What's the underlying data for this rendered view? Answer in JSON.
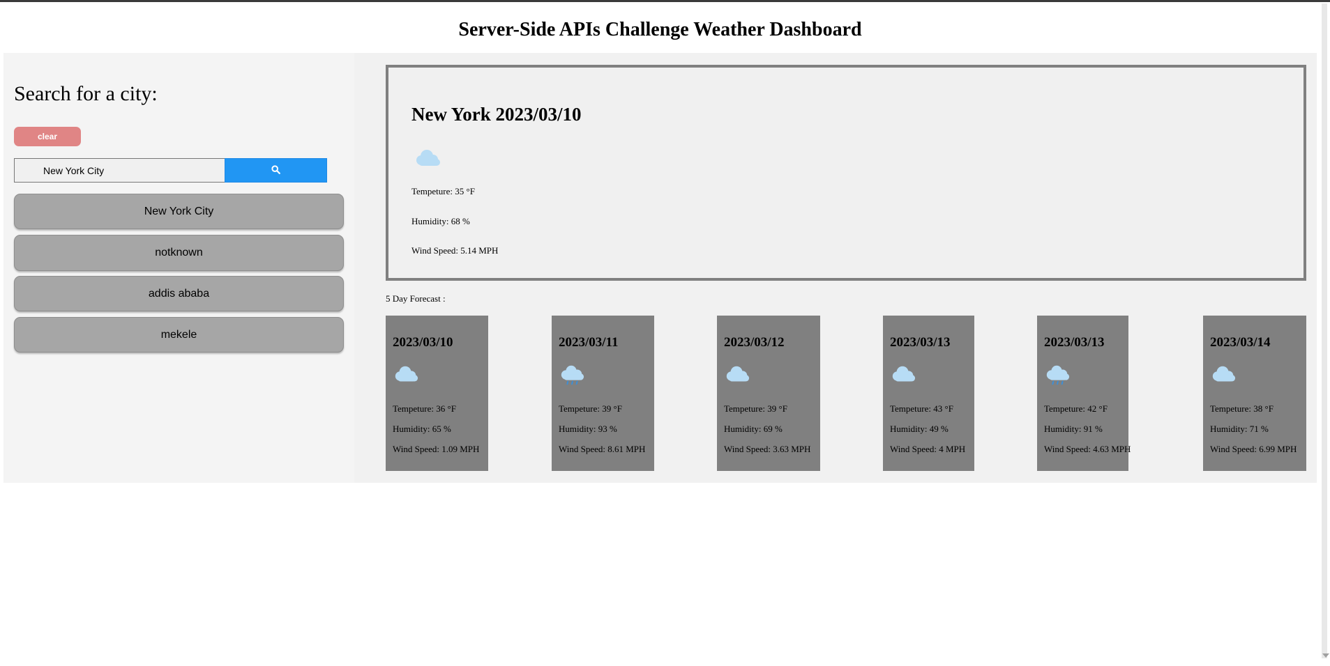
{
  "page": {
    "title": "Server-Side APIs Challenge Weather Dashboard"
  },
  "sidebar": {
    "heading": "Search for a city:",
    "clear_label": "clear",
    "search": {
      "value": "New York City",
      "icon": "search-icon"
    },
    "history": [
      "New York City",
      "notknown",
      "addis ababa",
      "mekele"
    ]
  },
  "current": {
    "title": "New York 2023/03/10",
    "icon": "cloud-icon",
    "temperature": "Tempeture: 35 °F",
    "humidity": "Humidity: 68 %",
    "wind": "Wind Speed: 5.14 MPH"
  },
  "forecast": {
    "label": "5 Day Forecast :",
    "cards": [
      {
        "date": "2023/03/10",
        "icon": "cloud-icon",
        "temperature": "Tempeture: 36 °F",
        "humidity": "Humidity: 65 %",
        "wind": "Wind Speed: 1.09 MPH"
      },
      {
        "date": "2023/03/11",
        "icon": "rain-cloud-icon",
        "temperature": "Tempeture: 39 °F",
        "humidity": "Humidity: 93 %",
        "wind": "Wind Speed: 8.61 MPH"
      },
      {
        "date": "2023/03/12",
        "icon": "cloud-icon",
        "temperature": "Tempeture: 39 °F",
        "humidity": "Humidity: 69 %",
        "wind": "Wind Speed: 3.63 MPH"
      },
      {
        "date": "2023/03/13",
        "icon": "cloud-icon",
        "temperature": "Tempeture: 43 °F",
        "humidity": "Humidity: 49 %",
        "wind": "Wind Speed: 4 MPH"
      },
      {
        "date": "2023/03/13",
        "icon": "rain-cloud-icon",
        "temperature": "Tempeture: 42 °F",
        "humidity": "Humidity: 91 %",
        "wind": "Wind Speed: 4.63 MPH"
      },
      {
        "date": "2023/03/14",
        "icon": "cloud-icon",
        "temperature": "Tempeture: 38 °F",
        "humidity": "Humidity: 71 %",
        "wind": "Wind Speed: 6.99 MPH"
      }
    ]
  },
  "colors": {
    "accent": "#2196f3",
    "clear_button": "#e08585",
    "card_background": "#808080",
    "history_button": "#a6a6a6",
    "cloud": "#b7dcf5",
    "rain": "#3b8fd8"
  }
}
